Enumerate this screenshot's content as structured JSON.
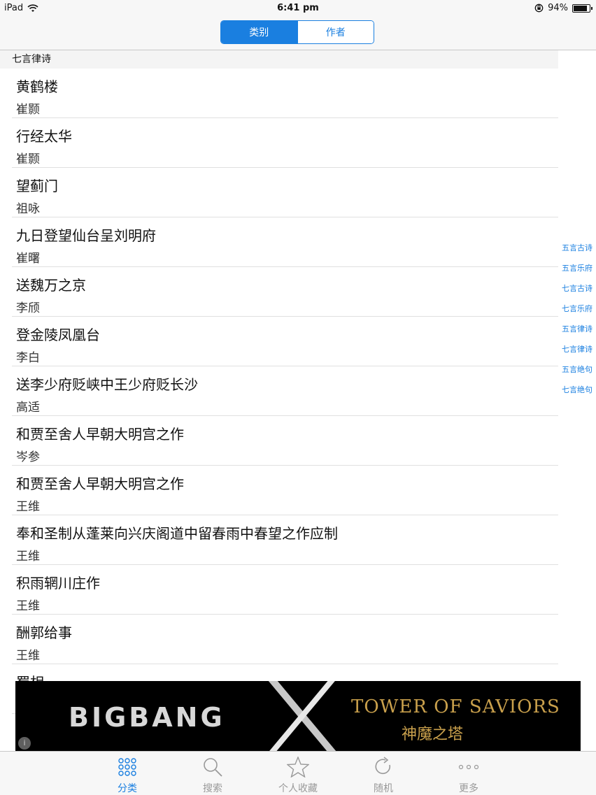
{
  "status_bar": {
    "device": "iPad",
    "time": "6:41 pm",
    "battery": "94%",
    "battery_level": 0.94
  },
  "nav": {
    "segments": [
      "类别",
      "作者"
    ],
    "selected_segment": "类别"
  },
  "section": {
    "header": "七言律诗"
  },
  "poems": [
    {
      "title": "黄鹤楼",
      "author": "崔颢"
    },
    {
      "title": "行经太华",
      "author": "崔颢"
    },
    {
      "title": "望蓟门",
      "author": "祖咏"
    },
    {
      "title": "九日登望仙台呈刘明府",
      "author": "崔曙"
    },
    {
      "title": "送魏万之京",
      "author": "李颀"
    },
    {
      "title": "登金陵凤凰台",
      "author": "李白"
    },
    {
      "title": "送李少府贬峡中王少府贬长沙",
      "author": "高适"
    },
    {
      "title": "和贾至舍人早朝大明宫之作",
      "author": "岑参"
    },
    {
      "title": "和贾至舍人早朝大明宫之作",
      "author": "王维"
    },
    {
      "title": "奉和圣制从蓬莱向兴庆阁道中留春雨中春望之作应制",
      "author": "王维"
    },
    {
      "title": "积雨辋川庄作",
      "author": "王维"
    },
    {
      "title": "酬郭给事",
      "author": "王维"
    },
    {
      "title": "蜀相",
      "author": ""
    }
  ],
  "index": [
    "五言古诗",
    "五言乐府",
    "七言古诗",
    "七言乐府",
    "五言律诗",
    "七言律诗",
    "五言绝句",
    "七言绝句"
  ],
  "ad": {
    "left_text": "BIGBANG",
    "right_text": "TOWER OF SAVIORS",
    "right_subtext": "神魔之塔"
  },
  "tabs": [
    {
      "label": "分类",
      "icon": "grid-icon",
      "active": true
    },
    {
      "label": "搜索",
      "icon": "search-icon",
      "active": false
    },
    {
      "label": "个人收藏",
      "icon": "star-icon",
      "active": false
    },
    {
      "label": "随机",
      "icon": "refresh-icon",
      "active": false
    },
    {
      "label": "更多",
      "icon": "more-icon",
      "active": false
    }
  ],
  "colors": {
    "accent": "#1a7fe0",
    "inactive": "#999999"
  }
}
